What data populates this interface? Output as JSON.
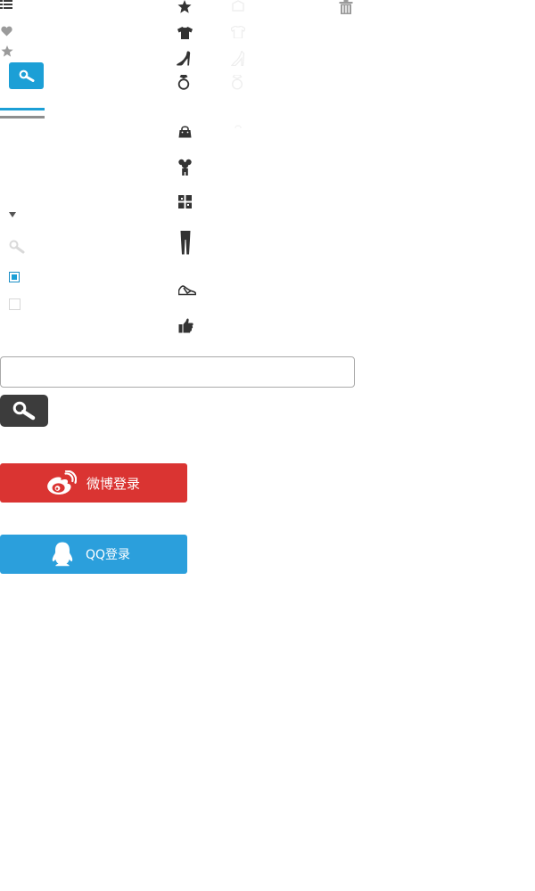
{
  "icons": {
    "list": "list-icon",
    "heart": "heart-icon",
    "star_gray": "star-icon",
    "search_blue_button": "search-icon",
    "caret": "caret-down-icon",
    "search_light": "search-icon",
    "checkbox_checked": "checkbox-checked-icon",
    "checkbox_empty": "checkbox-empty-icon",
    "trash": "trash-icon",
    "middle_column": [
      "star-icon",
      "tshirt-icon",
      "high-heel-icon",
      "ring-icon",
      "handbag-icon",
      "baby-clothes-icon",
      "gift-icon",
      "leggings-icon",
      "sandal-icon",
      "thumbs-up-icon"
    ]
  },
  "colors": {
    "accent_blue": "#1c9fd6",
    "weibo_red": "#da3432",
    "qq_blue": "#2b9fdc",
    "dark_button": "#3c3c3c",
    "icon_dark": "#333333",
    "icon_gray": "#9a9a9a"
  },
  "search": {
    "value": "",
    "placeholder": ""
  },
  "login": {
    "weibo_label": "微博登录",
    "qq_label": "QQ登录"
  }
}
